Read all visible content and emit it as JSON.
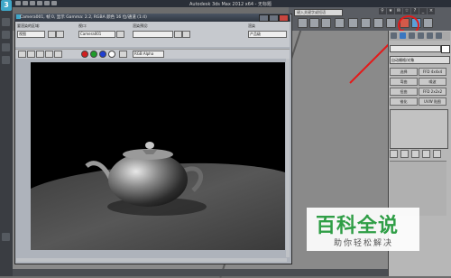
{
  "app": {
    "title": "Autodesk 3ds Max  2012 x64  -  无标题",
    "logo": "3",
    "search_placeholder": "键入关键字或短语"
  },
  "render_window": {
    "title": "Camera001, 帧 0, 显示 Gamma: 2.2, RGBA 颜色 16 位/通道 (1:4)",
    "area_label": "要渲染的区域:",
    "area_value": "视图",
    "viewport_label": "视口:",
    "viewport_value": "Camera001",
    "preset_label": "渲染预设:",
    "preset_value": "",
    "render_label": "渲染",
    "render_value": "产品级",
    "channel_value": "RGB Alpha",
    "channel_colors": [
      "#d21f1f",
      "#1f9d2a",
      "#1f3fd2",
      "#ffffff"
    ]
  },
  "command_panel": {
    "object_type": "自动栅格/对象",
    "buttons": [
      "选择",
      "FFD 4x4x4",
      "弯曲",
      "噪波",
      "扭曲",
      "FFD 2x2x2",
      "锥化",
      "UVW 贴图"
    ]
  },
  "watermark": {
    "title": "百科全说",
    "subtitle": "助你轻松解决"
  },
  "colors": {
    "annotation": "#e31b1b",
    "watermark_green": "#2f9e46"
  }
}
